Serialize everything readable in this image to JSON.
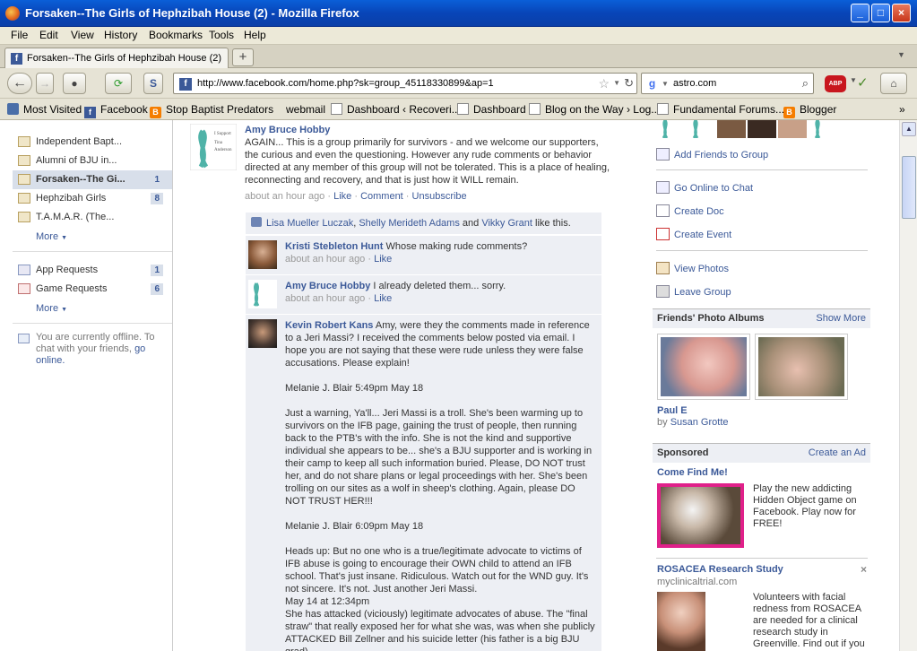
{
  "window": {
    "title": "Forsaken--The Girls of Hephzibah House (2) - Mozilla Firefox",
    "min": "_",
    "max": "□",
    "close": "×"
  },
  "menu": [
    "File",
    "Edit",
    "View",
    "History",
    "Bookmarks",
    "Tools",
    "Help"
  ],
  "tab": {
    "label": "Forsaken--The Girls of Hephzibah House (2)",
    "new": "+"
  },
  "nav": {
    "url": "http://www.facebook.com/home.php?sk=group_45118330899&ap=1",
    "search": "astro.com",
    "abp": "ABP"
  },
  "bookmarks": [
    "Most Visited",
    "Facebook",
    "Stop Baptist Predators",
    "webmail",
    "Dashboard ‹ Recoveri...",
    "Dashboard",
    "Blog on the Way › Log...",
    "Fundamental Forums....",
    "Blogger"
  ],
  "sidebar": {
    "groups": [
      {
        "label": "Independent Bapt...",
        "count": ""
      },
      {
        "label": "Alumni of BJU in...",
        "count": ""
      },
      {
        "label": "Forsaken--The Gi...",
        "count": "1"
      },
      {
        "label": "Hephzibah Girls",
        "count": "8"
      },
      {
        "label": "T.A.M.A.R. (The...",
        "count": ""
      }
    ],
    "more1": "More",
    "requests": [
      {
        "label": "App Requests",
        "count": "1"
      },
      {
        "label": "Game Requests",
        "count": "6"
      }
    ],
    "more2": "More",
    "offline_text": "You are currently offline. To chat with your friends,",
    "offline_link": "go online."
  },
  "post": {
    "author": "Amy Bruce Hobby",
    "body": "AGAIN... This is a group primarily for survivors - and we welcome our supporters, the curious and even the questioning. However any rude comments or behavior directed at any member of this group will not be tolerated. This is a place of healing, reconnecting and recovery, and that is just how it WILL remain.",
    "time": "about an hour ago",
    "like": "Like",
    "comment": "Comment",
    "unsubscribe": "Unsubscribe",
    "likers": [
      "Lisa Mueller Luczak",
      "Shelly Merideth Adams",
      "Vikky Grant"
    ],
    "likes_suffix": "like this."
  },
  "comments": [
    {
      "author": "Kristi Stebleton Hunt",
      "text": "Whose making rude comments?",
      "time": "about an hour ago",
      "like": "Like"
    },
    {
      "author": "Amy Bruce Hobby",
      "text": "I already deleted them... sorry.",
      "time": "about an hour ago",
      "like": "Like"
    },
    {
      "author": "Kevin Robert Kans",
      "p1": "Amy, were they the comments made in reference to a Jeri Massi? I received the comments below posted via email. I hope you are not saying that these were rude unless they were false accusations. Please explain!",
      "p2": "Melanie J. Blair 5:49pm May 18",
      "p3": "Just a warning, Ya'll... Jeri Massi is a troll. She's been warming up to survivors on the IFB page, gaining the trust of people, then running back to the PTB's with the info. She is not the kind and supportive individual she appears to be... she's a BJU supporter and is working in their camp to keep all such information buried. Please, DO NOT trust her, and do not share plans or legal proceedings with her. She's been trolling on our sites as a wolf in sheep's clothing. Again, please DO NOT TRUST HER!!!",
      "p4": "Melanie J. Blair 6:09pm May 18",
      "p5": "Heads up: But no one who is a true/legitimate advocate to victims of IFB abuse is going to encourage their OWN child to attend an IFB school. That's just insane. Ridiculous. Watch out for the WND guy. It's not sincere. It's not. Just another Jeri Massi.",
      "p6": "May 14 at 12:34pm",
      "p7": "She has attacked (viciously) legitimate advocates of abuse. The \"final straw\" that really exposed her for what she was, was when she publicly ATTACKED Bill Zellner and his suicide letter (his father is a big BJU grad)"
    }
  ],
  "right": {
    "add_friends": "Add Friends to Group",
    "go_chat": "Go Online to Chat",
    "create_doc": "Create Doc",
    "create_event": "Create Event",
    "view_photos": "View Photos",
    "leave_group": "Leave Group",
    "albums_title": "Friends' Photo Albums",
    "show_more": "Show More",
    "album_name": "Paul E",
    "album_by": "by",
    "album_owner": "Susan Grotte",
    "sponsored": "Sponsored",
    "create_ad": "Create an Ad",
    "ad1_title": "Come Find Me!",
    "ad1_text": "Play the new addicting Hidden Object game on Facebook. Play now for FREE!",
    "ad2_title": "ROSACEA Research Study",
    "ad2_site": "myclinicaltrial.com",
    "ad2_close": "×",
    "ad2_text": "Volunteers with facial redness from ROSACEA are needed for a clinical research study in Greenville. Find out if you"
  }
}
